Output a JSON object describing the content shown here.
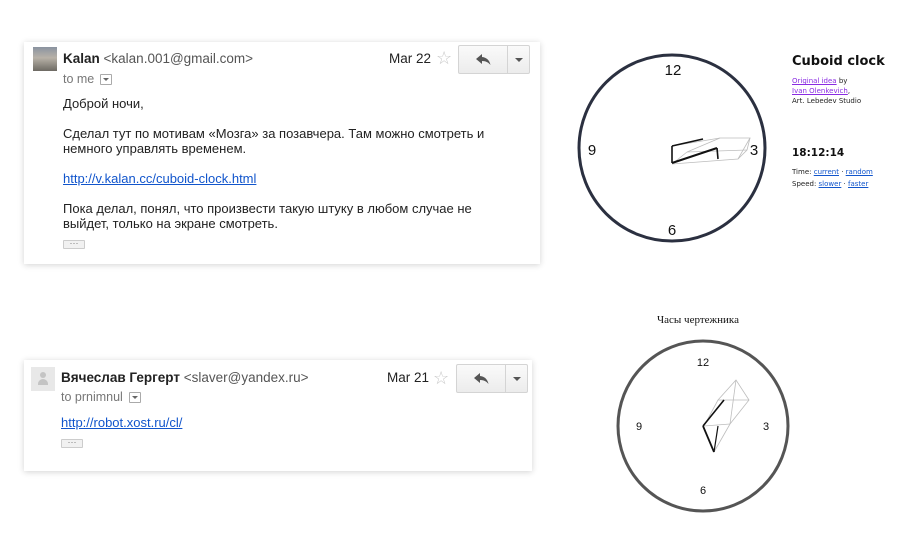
{
  "email1": {
    "sender_name": "Kalan",
    "sender_email": "<kalan.001@gmail.com>",
    "date": "Mar 22",
    "recipient": "to me",
    "greeting": "Доброй ночи,",
    "para1_line1": "Сделал тут по мотивам «Мозга» за позавчера. Там можно смотреть и",
    "para1_line2": "немного управлять временем.",
    "link": "http://v.kalan.cc/cuboid-clock.html",
    "para2_line1": "Пока делал, понял, что произвести такую штуку в любом случае не",
    "para2_line2": "выйдет, только на экране смотреть.",
    "ellipsis": "···"
  },
  "email2": {
    "sender_name": "Вячеслав Гергерт",
    "sender_email": "<slaver@yandex.ru>",
    "date": "Mar 21",
    "recipient": "to prnimnul",
    "link": "http://robot.xost.ru/cl/",
    "ellipsis": "···"
  },
  "cuboid_clock": {
    "title": "Cuboid clock",
    "original_idea": "Original idea",
    "by": " by",
    "author": "Ivan Olenkevich",
    "author_suffix": ",",
    "studio": "Art. Lebedev Studio",
    "time": "18:12:14",
    "time_label": "Time: ",
    "time_current": "current",
    "time_sep": " · ",
    "time_random": "random",
    "speed_label": "Speed: ",
    "speed_slower": "slower",
    "speed_sep": " · ",
    "speed_faster": "faster",
    "dial": {
      "n12": "12",
      "n3": "3",
      "n6": "6",
      "n9": "9"
    }
  },
  "drafter_clock": {
    "title": "Часы чертежника",
    "dial": {
      "n12": "12",
      "n3": "3",
      "n6": "6",
      "n9": "9"
    }
  },
  "icons": {
    "reply": "reply-arrow-icon",
    "star": "star-icon",
    "more": "chevron-down-icon",
    "avatar": "person-icon"
  }
}
